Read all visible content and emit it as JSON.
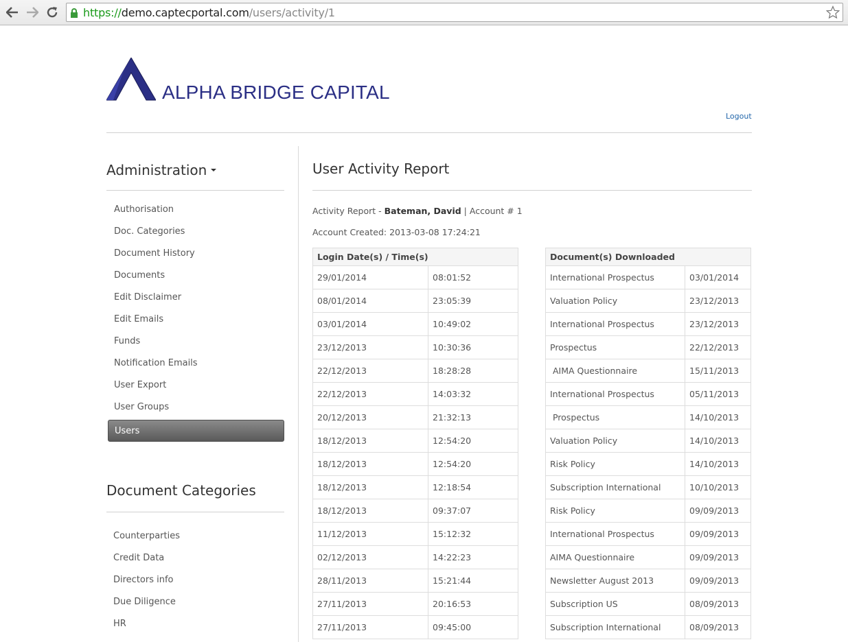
{
  "browser": {
    "url_scheme": "https://",
    "url_host": "demo.captecportal.com",
    "url_path": "/users/activity/1"
  },
  "header": {
    "logo_text": "ALPHA BRIDGE CAPITAL",
    "logo_color": "#2b2f85",
    "logout_label": "Logout"
  },
  "sidebar": {
    "admin_title": "Administration",
    "admin_items": [
      {
        "label": "Authorisation"
      },
      {
        "label": "Doc. Categories"
      },
      {
        "label": "Document History"
      },
      {
        "label": "Documents"
      },
      {
        "label": "Edit Disclaimer"
      },
      {
        "label": "Edit Emails"
      },
      {
        "label": "Funds"
      },
      {
        "label": "Notification Emails"
      },
      {
        "label": "User Export"
      },
      {
        "label": "User Groups"
      },
      {
        "label": "Users",
        "active": true
      }
    ],
    "categories_title": "Document Categories",
    "category_items": [
      {
        "label": "Counterparties"
      },
      {
        "label": "Credit Data"
      },
      {
        "label": "Directors info"
      },
      {
        "label": "Due Diligence"
      },
      {
        "label": "HR"
      }
    ]
  },
  "main": {
    "title": "User Activity Report",
    "report_prefix": "Activity Report - ",
    "user_name": "Bateman, David",
    "account_label": " | Account # 1",
    "created_label": "Account Created: 2013-03-08 17:24:21",
    "login_header": "Login Date(s) / Time(s)",
    "logins": [
      {
        "date": "29/01/2014",
        "time": "08:01:52"
      },
      {
        "date": "08/01/2014",
        "time": "23:05:39"
      },
      {
        "date": "03/01/2014",
        "time": "10:49:02"
      },
      {
        "date": "23/12/2013",
        "time": "10:30:36"
      },
      {
        "date": "22/12/2013",
        "time": "18:28:28"
      },
      {
        "date": "22/12/2013",
        "time": "14:03:32"
      },
      {
        "date": "20/12/2013",
        "time": "21:32:13"
      },
      {
        "date": "18/12/2013",
        "time": "12:54:20"
      },
      {
        "date": "18/12/2013",
        "time": "12:54:20"
      },
      {
        "date": "18/12/2013",
        "time": "12:18:54"
      },
      {
        "date": "18/12/2013",
        "time": "09:37:07"
      },
      {
        "date": "11/12/2013",
        "time": "15:12:32"
      },
      {
        "date": "02/12/2013",
        "time": "14:22:23"
      },
      {
        "date": "28/11/2013",
        "time": "15:21:44"
      },
      {
        "date": "27/11/2013",
        "time": "20:16:53"
      },
      {
        "date": "27/11/2013",
        "time": "09:45:00"
      }
    ],
    "docs_header": "Document(s) Downloaded",
    "downloads": [
      {
        "name": "International Prospectus",
        "date": "03/01/2014"
      },
      {
        "name": "Valuation Policy",
        "date": "23/12/2013"
      },
      {
        "name": "International Prospectus",
        "date": "23/12/2013"
      },
      {
        "name": "Prospectus",
        "date": "22/12/2013"
      },
      {
        "name": " AIMA Questionnaire",
        "date": "15/11/2013"
      },
      {
        "name": "International Prospectus",
        "date": "05/11/2013"
      },
      {
        "name": " Prospectus",
        "date": "14/10/2013"
      },
      {
        "name": "Valuation Policy",
        "date": "14/10/2013"
      },
      {
        "name": "Risk Policy",
        "date": "14/10/2013"
      },
      {
        "name": "Subscription International",
        "date": "10/10/2013"
      },
      {
        "name": "Risk Policy",
        "date": "09/09/2013"
      },
      {
        "name": "International Prospectus",
        "date": "09/09/2013"
      },
      {
        "name": "AIMA Questionnaire",
        "date": "09/09/2013"
      },
      {
        "name": "Newsletter August 2013",
        "date": "09/09/2013"
      },
      {
        "name": "Subscription US",
        "date": "08/09/2013"
      },
      {
        "name": "Subscription International",
        "date": "08/09/2013"
      }
    ]
  }
}
